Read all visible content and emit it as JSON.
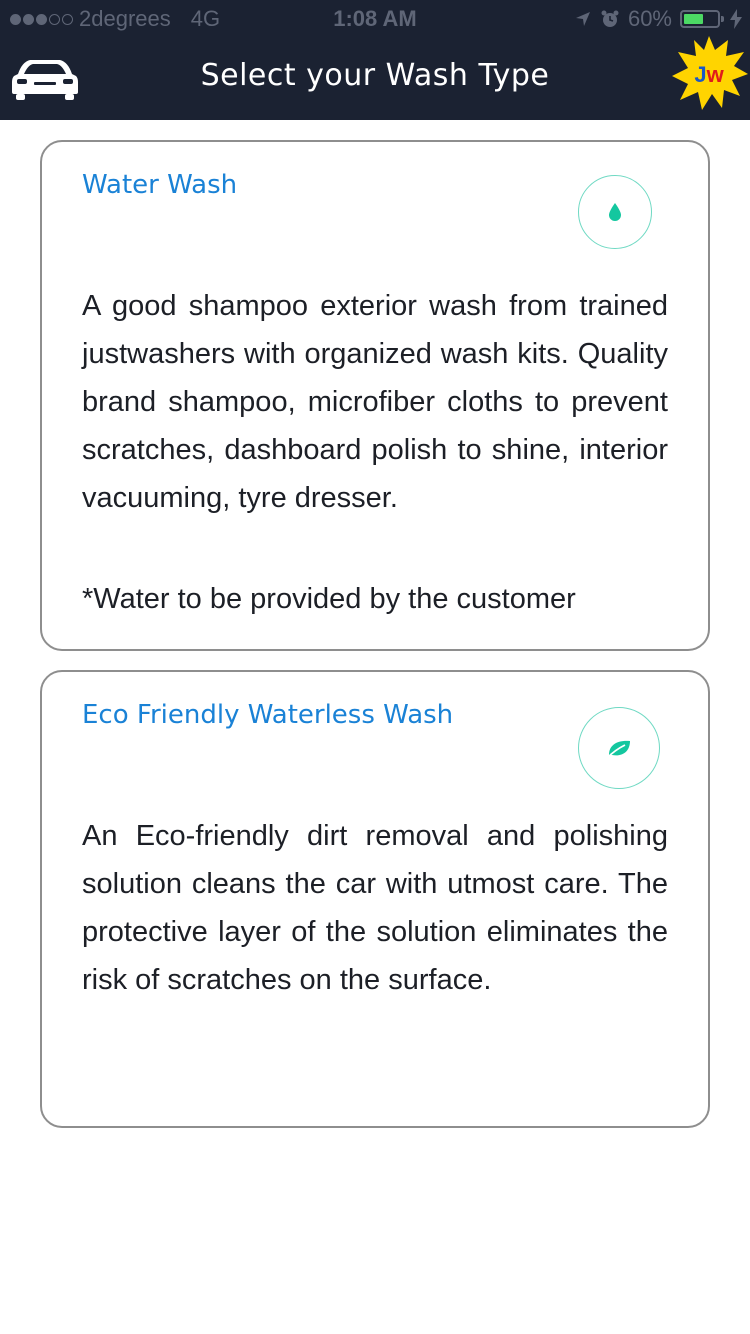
{
  "status_bar": {
    "carrier": "2degrees",
    "network": "4G",
    "time": "1:08 AM",
    "battery_percent": "60%",
    "battery_level": 0.6,
    "signal_bars": 3,
    "signal_total": 5
  },
  "header": {
    "title": "Select your Wash Type",
    "logo_text": "Jw",
    "background_color": "#1b2232"
  },
  "wash_types": [
    {
      "title": "Water Wash",
      "icon": "water-drop-icon",
      "description": "A good shampoo exterior wash from trained justwashers with organized wash kits. Quality brand shampoo, microfiber cloths to prevent scratches, dashboard polish to shine, interior vacuuming, tyre dresser.",
      "note": "*Water to be provided by the customer"
    },
    {
      "title": "Eco Friendly Waterless Wash",
      "icon": "leaf-icon",
      "description": "An Eco-friendly dirt removal and polishing solution cleans the car with utmost care. The protective layer of the solution eliminates the risk of scratches on the surface."
    }
  ],
  "colors": {
    "accent_title": "#1a82d6",
    "icon_teal": "#14c79f",
    "card_border": "#8e8e8e"
  }
}
